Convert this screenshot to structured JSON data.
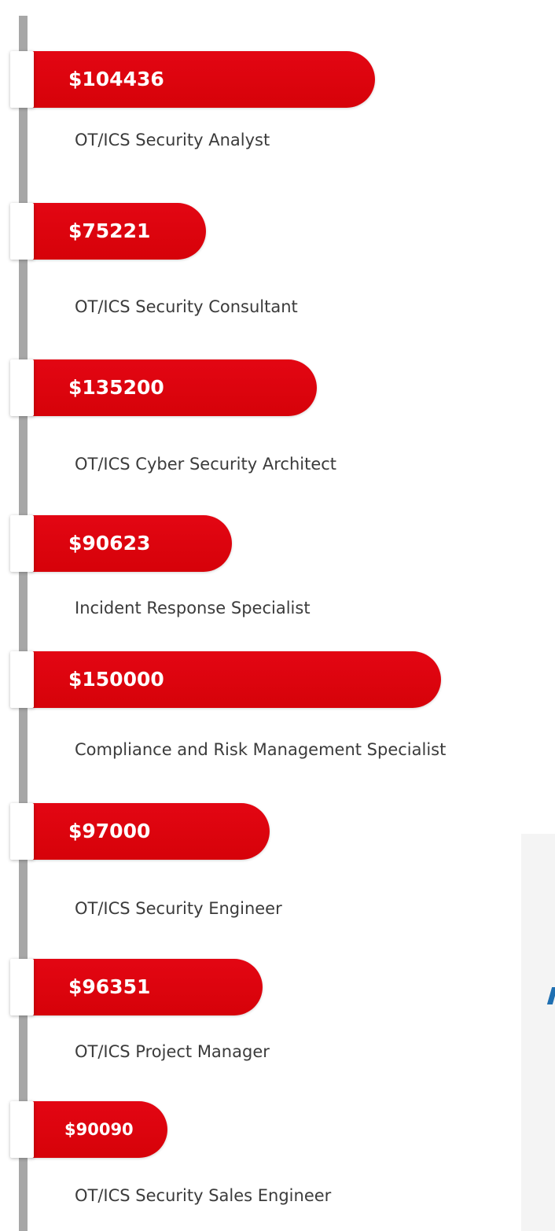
{
  "chart_data": {
    "type": "bar",
    "categories": [
      "OT/ICS Security Analyst",
      "OT/ICS Security Consultant",
      "OT/ICS Cyber Security Architect",
      "Incident Response Specialist",
      "Compliance and Risk Management Specialist",
      "OT/ICS Security Engineer",
      "OT/ICS Project Manager",
      "OT/ICS Security Sales Engineer"
    ],
    "values": [
      104436,
      75221,
      135200,
      90623,
      150000,
      97000,
      96351,
      90090
    ],
    "value_labels": [
      "$104436",
      "$75221",
      "$135200",
      "$90623",
      "$150000",
      "$97000",
      "$96351",
      "$90090"
    ],
    "bar_color": "#e30613"
  }
}
